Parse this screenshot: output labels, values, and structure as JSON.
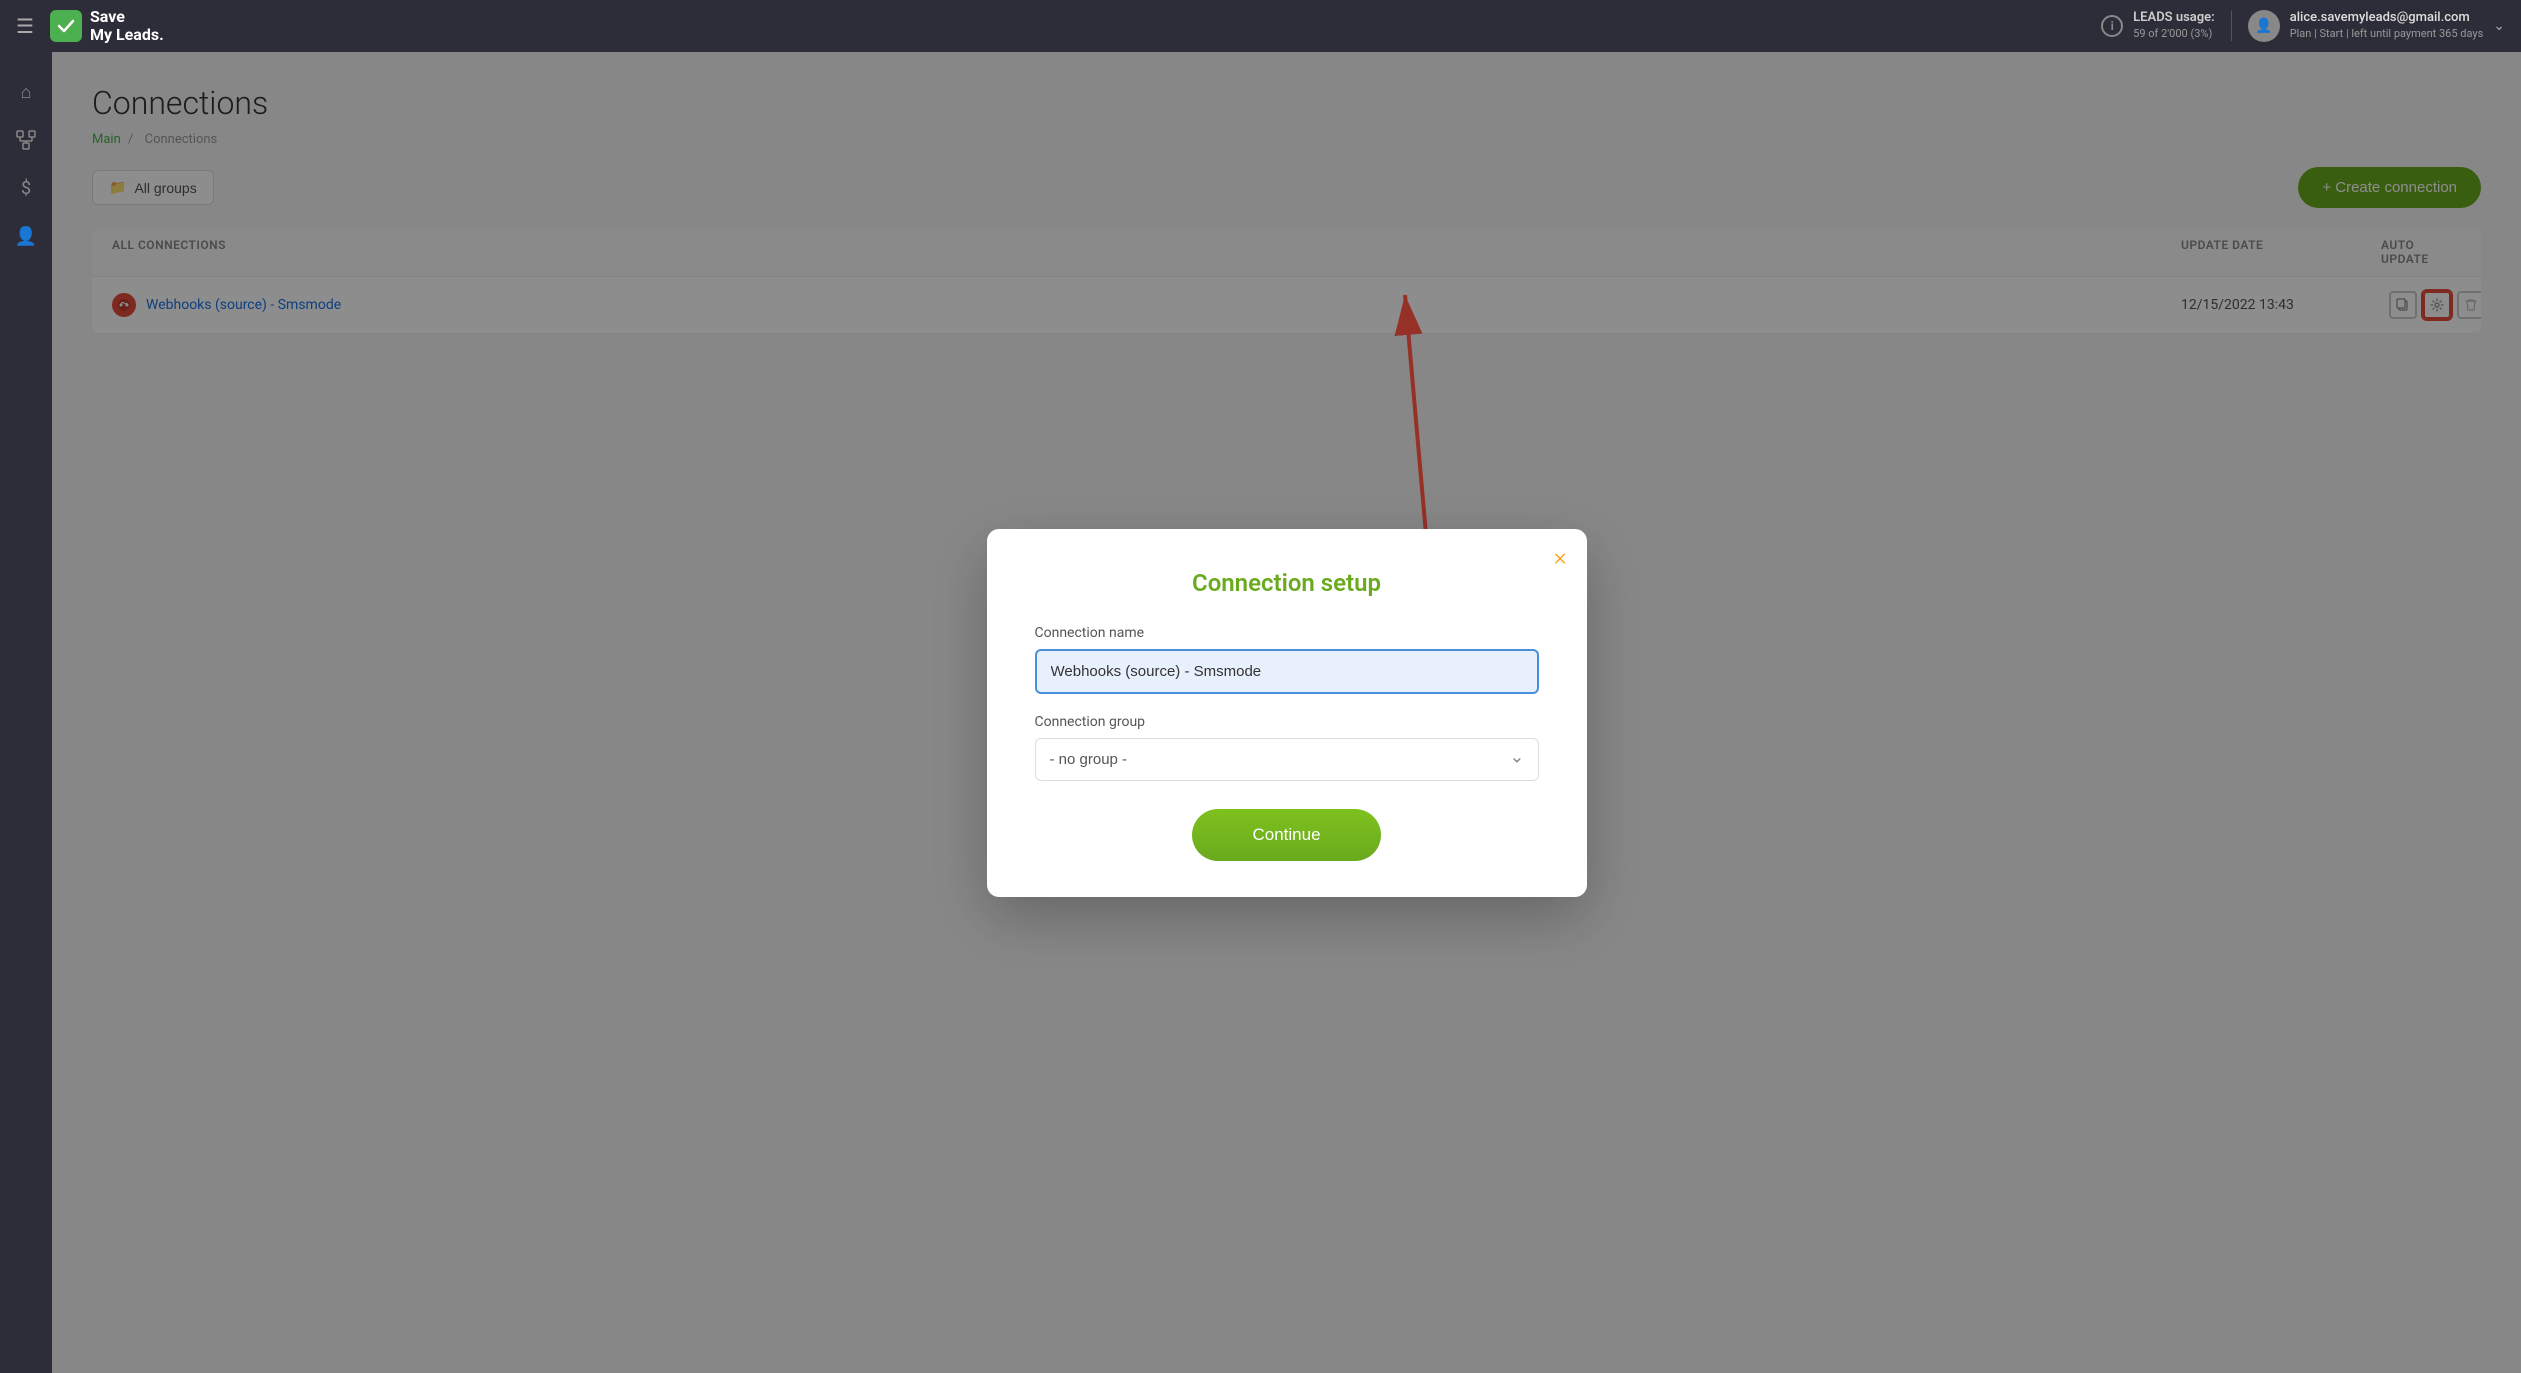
{
  "topnav": {
    "hamburger_icon": "☰",
    "logo_line1": "Save",
    "logo_line2": "My Leads.",
    "logo_icon": "✓",
    "leads_label": "LEADS usage:",
    "leads_value": "59 of 2'000 (3%)",
    "info_icon": "i",
    "user_email": "alice.savemyleads@gmail.com",
    "user_plan": "Plan | Start | left until payment 365 days",
    "chevron": "⌄"
  },
  "sidebar": {
    "items": [
      {
        "icon": "⌂",
        "name": "home"
      },
      {
        "icon": "⎇",
        "name": "connections"
      },
      {
        "icon": "$",
        "name": "billing"
      },
      {
        "icon": "👤",
        "name": "profile"
      }
    ]
  },
  "page": {
    "title": "Connections",
    "breadcrumb_main": "Main",
    "breadcrumb_sep": "/",
    "breadcrumb_current": "Connections",
    "all_groups_label": "All groups",
    "create_connection_label": "+ Create connection"
  },
  "table": {
    "headers": [
      "ALL CONNECTIONS",
      "",
      "UPDATE DATE",
      "AUTO UPDATE"
    ],
    "rows": [
      {
        "name": "Webhooks (source) - Smsmode",
        "date": "12/15/2022 13:43"
      }
    ]
  },
  "modal": {
    "close_icon": "×",
    "title": "Connection setup",
    "connection_name_label": "Connection name",
    "connection_name_value": "Webhooks (source) - Smsmode",
    "connection_group_label": "Connection group",
    "group_options": [
      "- no group -"
    ],
    "group_selected": "- no group -",
    "continue_label": "Continue"
  }
}
